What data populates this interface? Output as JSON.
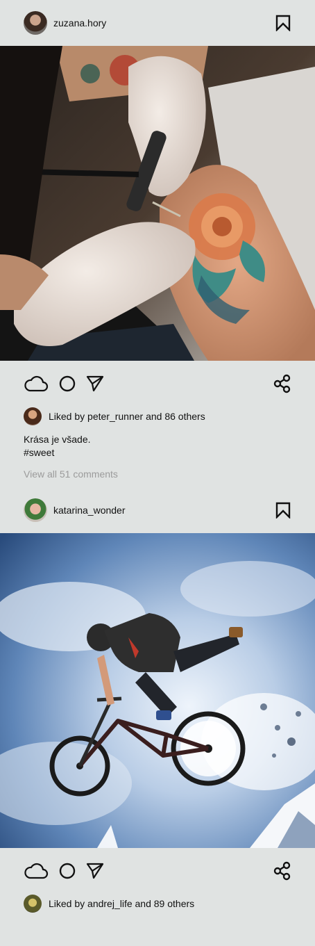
{
  "posts": [
    {
      "username": "zuzana.hory",
      "liked_by_text": "Liked by peter_runner and 86 others",
      "caption_line1": "Krása je všade.",
      "caption_line2": "#sweet",
      "view_comments": "View all 51 comments",
      "photo_description": "tattoo-artist-photo"
    },
    {
      "username": "katarina_wonder",
      "liked_by_text": "Liked by andrej_life and 89 others",
      "photo_description": "bmx-jump-photo"
    }
  ],
  "icons": {
    "bookmark": "bookmark-icon",
    "like": "cloud-like-icon",
    "comment": "circle-comment-icon",
    "send": "send-icon",
    "share": "share-icon"
  },
  "colors": {
    "background": "#e0e3e2",
    "text": "#111111",
    "muted": "#9b9b9b"
  }
}
